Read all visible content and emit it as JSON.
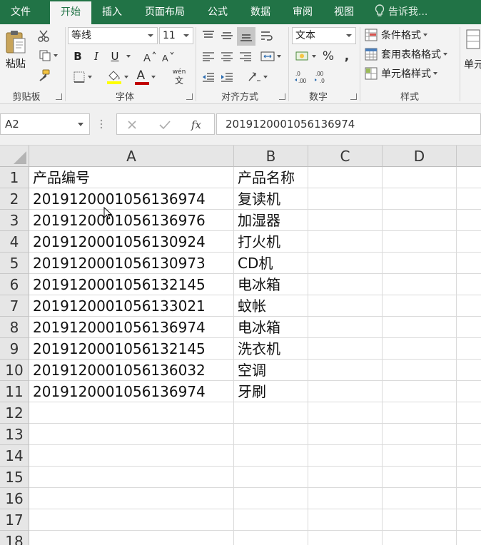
{
  "tabs": [
    {
      "label": "文件",
      "active": false
    },
    {
      "label": "开始",
      "active": true
    },
    {
      "label": "插入",
      "active": false
    },
    {
      "label": "页面布局",
      "active": false
    },
    {
      "label": "公式",
      "active": false
    },
    {
      "label": "数据",
      "active": false
    },
    {
      "label": "审阅",
      "active": false
    },
    {
      "label": "视图",
      "active": false
    }
  ],
  "tell_me": "告诉我...",
  "ribbon": {
    "clipboard": {
      "paste_label": "粘贴",
      "group_label": "剪贴板"
    },
    "font": {
      "font_name": "等线",
      "font_size": "11",
      "bold": "B",
      "italic": "I",
      "underline": "U",
      "font_color_glyph": "A",
      "highlight_color": "#ffff00",
      "font_color": "#c00000",
      "phonetic_top": "wén",
      "phonetic_bottom": "文",
      "group_label": "字体"
    },
    "alignment": {
      "group_label": "对齐方式"
    },
    "number": {
      "format": "文本",
      "percent": "%",
      "comma": ",",
      "group_label": "数字"
    },
    "styles": {
      "conditional": "条件格式",
      "table_format": "套用表格格式",
      "cell_styles": "单元格样式",
      "group_label": "样式"
    },
    "cells": {
      "label": "单元"
    }
  },
  "formula_bar": {
    "name_box": "A2",
    "formula": "2019120001056136974"
  },
  "sheet": {
    "columns": [
      "A",
      "B",
      "C",
      "D"
    ],
    "row_numbers": [
      "1",
      "2",
      "3",
      "4",
      "5",
      "6",
      "7",
      "8",
      "9",
      "10",
      "11",
      "12",
      "13",
      "14",
      "15",
      "16",
      "17",
      "18"
    ],
    "rows": [
      [
        "产品编号",
        "产品名称"
      ],
      [
        "2019120001056136974",
        "复读机"
      ],
      [
        "2019120001056136976",
        "加湿器"
      ],
      [
        "2019120001056130924",
        "打火机"
      ],
      [
        "2019120001056130973",
        "CD机"
      ],
      [
        "2019120001056132145",
        "电冰箱"
      ],
      [
        "2019120001056133021",
        "蚊帐"
      ],
      [
        "2019120001056136974",
        "电冰箱"
      ],
      [
        "2019120001056132145",
        "洗衣机"
      ],
      [
        "2019120001056136032",
        "空调"
      ],
      [
        "2019120001056136974",
        "牙刷"
      ]
    ]
  },
  "colors": {
    "accent": "#217346",
    "header_bg": "#e6e6e6",
    "ribbon_bg": "#f3f3f3"
  }
}
